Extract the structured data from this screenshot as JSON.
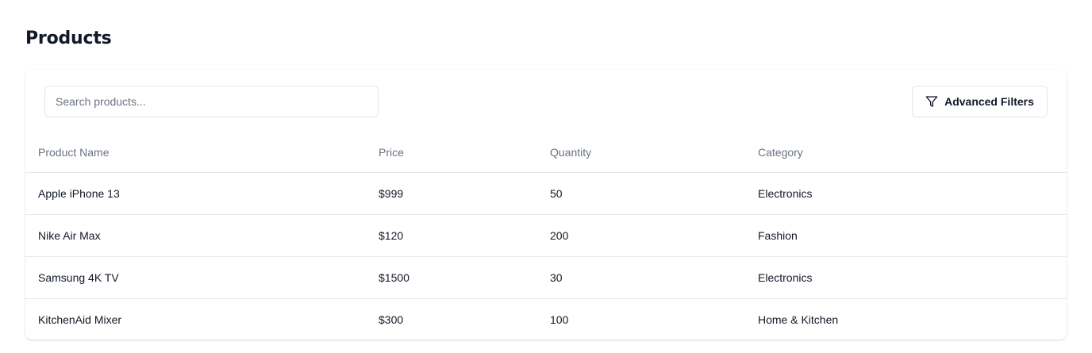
{
  "page": {
    "title": "Products"
  },
  "search": {
    "placeholder": "Search products...",
    "value": ""
  },
  "toolbar": {
    "filters_label": "Advanced Filters",
    "filters_icon": "filter-funnel-icon"
  },
  "table": {
    "columns": [
      "Product Name",
      "Price",
      "Quantity",
      "Category"
    ],
    "rows": [
      {
        "name": "Apple iPhone 13",
        "price": "$999",
        "quantity": "50",
        "category": "Electronics"
      },
      {
        "name": "Nike Air Max",
        "price": "$120",
        "quantity": "200",
        "category": "Fashion"
      },
      {
        "name": "Samsung 4K TV",
        "price": "$1500",
        "quantity": "30",
        "category": "Electronics"
      },
      {
        "name": "KitchenAid Mixer",
        "price": "$300",
        "quantity": "100",
        "category": "Home & Kitchen"
      }
    ]
  },
  "colors": {
    "border": "#e5e7eb",
    "muted_text": "#6b7280",
    "text": "#111827"
  }
}
